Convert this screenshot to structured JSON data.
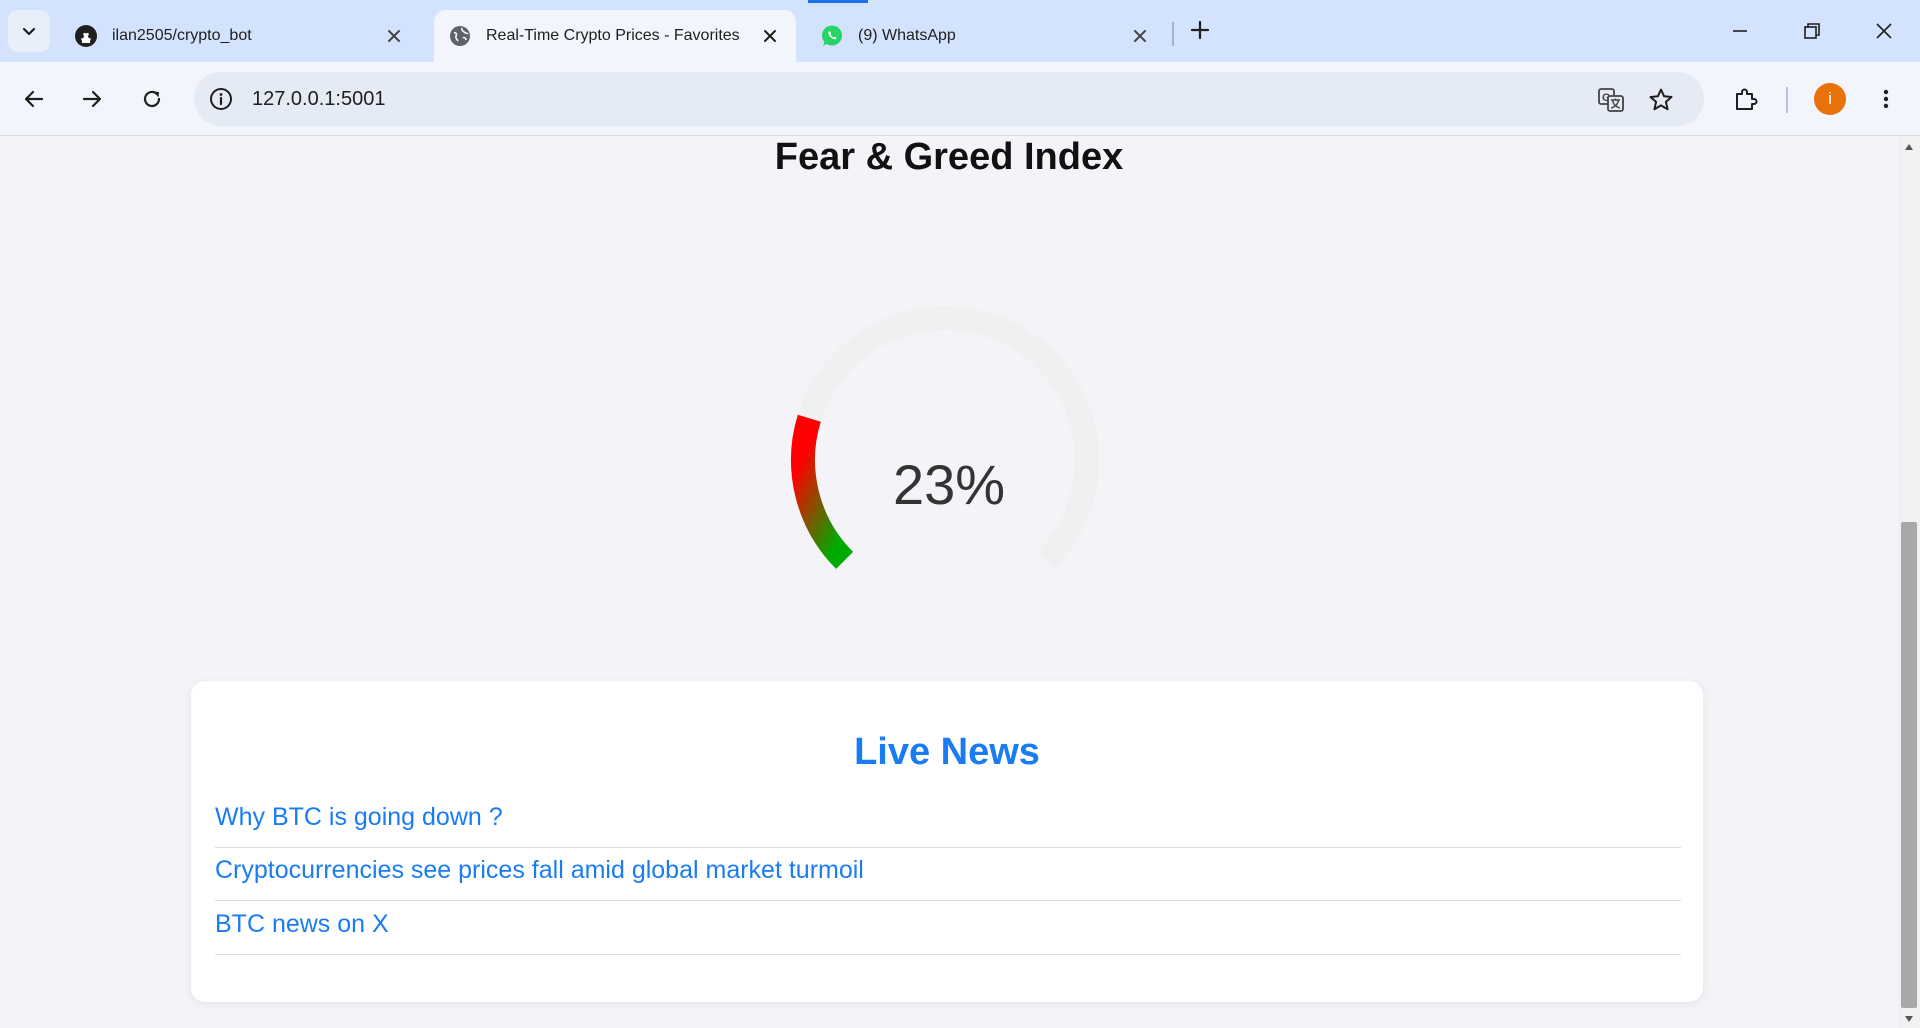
{
  "browser": {
    "tabs": [
      {
        "title": "ilan2505/crypto_bot",
        "favicon": "github-icon"
      },
      {
        "title": "Real-Time Crypto Prices - Favorites",
        "favicon": "globe-icon"
      },
      {
        "title": "(9) WhatsApp",
        "favicon": "whatsapp-icon"
      }
    ],
    "active_tab": 1,
    "url": "127.0.0.1:5001",
    "profile_initial": "i",
    "profile_color": "#e8710a"
  },
  "page": {
    "fear_greed": {
      "title": "Fear & Greed Index",
      "value": 23,
      "value_label": "23%",
      "gradient_start": "#ff0000",
      "gradient_end": "#00aa00",
      "track_color": "#f0f0f0"
    },
    "news": {
      "title": "Live News",
      "items": [
        "Why BTC is going down ?",
        "Cryptocurrencies see prices fall amid global market turmoil",
        "BTC news on X"
      ]
    }
  }
}
